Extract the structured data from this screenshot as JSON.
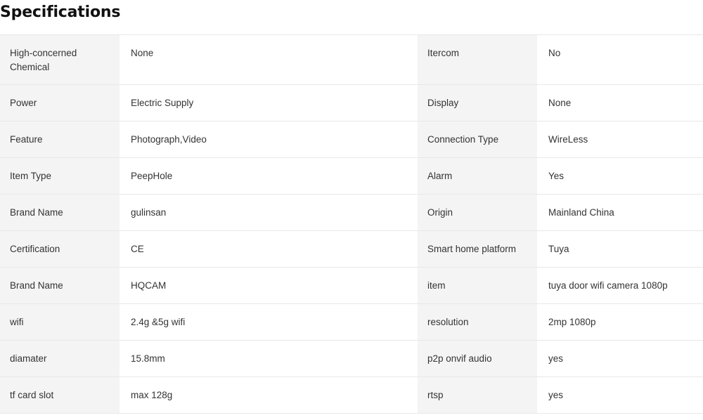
{
  "heading": "Specifications",
  "rows": [
    {
      "l1": "High-concerned Chemical",
      "v1": "None",
      "l2": "Itercom",
      "v2": "No"
    },
    {
      "l1": "Power",
      "v1": "Electric Supply",
      "l2": "Display",
      "v2": "None"
    },
    {
      "l1": "Feature",
      "v1": "Photograph,Video",
      "l2": "Connection Type",
      "v2": "WireLess"
    },
    {
      "l1": "Item Type",
      "v1": "PeepHole",
      "l2": "Alarm",
      "v2": "Yes"
    },
    {
      "l1": "Brand Name",
      "v1": "gulinsan",
      "l2": "Origin",
      "v2": "Mainland China"
    },
    {
      "l1": "Certification",
      "v1": "CE",
      "l2": "Smart home platform",
      "v2": "Tuya"
    },
    {
      "l1": "Brand Name",
      "v1": "HQCAM",
      "l2": "item",
      "v2": "tuya door wifi camera 1080p"
    },
    {
      "l1": "wifi",
      "v1": "2.4g &5g wifi",
      "l2": "resolution",
      "v2": "2mp 1080p"
    },
    {
      "l1": "diamater",
      "v1": "15.8mm",
      "l2": "p2p onvif audio",
      "v2": "yes"
    },
    {
      "l1": "tf card slot",
      "v1": "max 128g",
      "l2": "rtsp",
      "v2": "yes"
    }
  ]
}
